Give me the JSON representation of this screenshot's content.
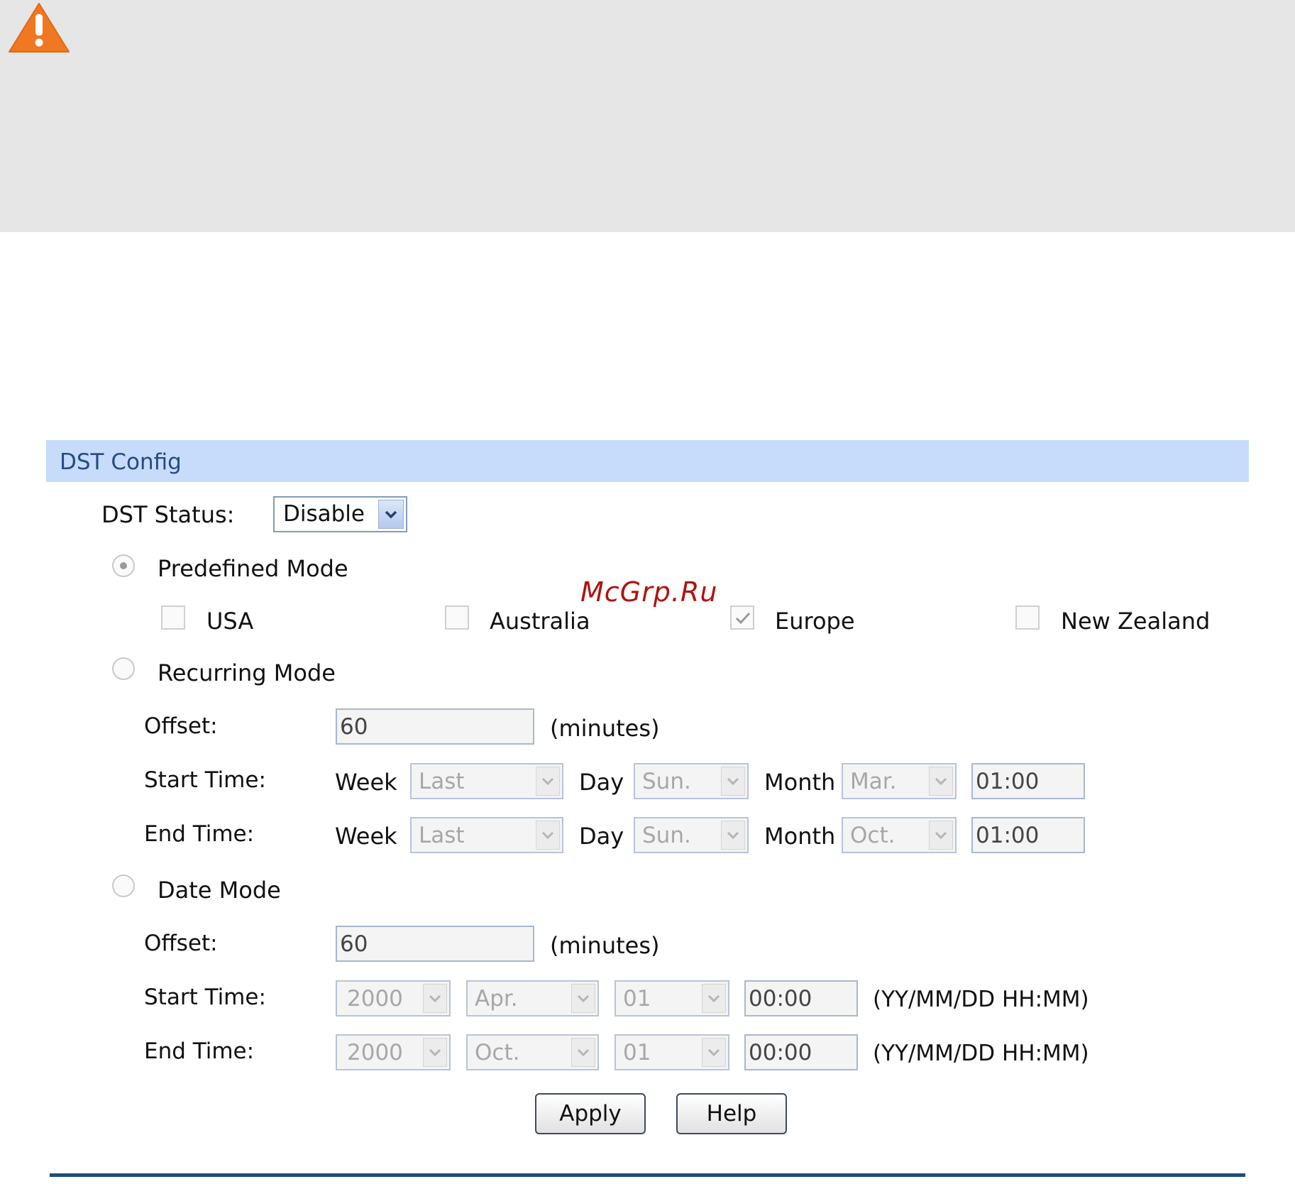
{
  "warning": {
    "icon": "warning-triangle-icon",
    "color": "#f07820"
  },
  "section": {
    "title": "DST Config",
    "header_color": "#c6dcfa"
  },
  "dst_status": {
    "label": "DST Status:",
    "value": "Disable"
  },
  "predefined": {
    "label": "Predefined Mode",
    "options": [
      {
        "label": "USA",
        "checked": false
      },
      {
        "label": "Australia",
        "checked": false
      },
      {
        "label": "Europe",
        "checked": true
      },
      {
        "label": "New Zealand",
        "checked": false
      }
    ]
  },
  "recurring": {
    "label": "Recurring Mode",
    "offset_label": "Offset:",
    "offset_value": "60",
    "offset_unit": "(minutes)",
    "start": {
      "label": "Start Time:",
      "week_label": "Week",
      "week": "Last",
      "day_label": "Day",
      "day": "Sun.",
      "month_label": "Month",
      "month": "Mar.",
      "time": "01:00"
    },
    "end": {
      "label": "End Time:",
      "week_label": "Week",
      "week": "Last",
      "day_label": "Day",
      "day": "Sun.",
      "month_label": "Month",
      "month": "Oct.",
      "time": "01:00"
    }
  },
  "date_mode": {
    "label": "Date Mode",
    "offset_label": "Offset:",
    "offset_value": "60",
    "offset_unit": "(minutes)",
    "start": {
      "label": "Start Time:",
      "year": "2000",
      "month": "Apr.",
      "day": "01",
      "time": "00:00",
      "format": "(YY/MM/DD HH:MM)"
    },
    "end": {
      "label": "End Time:",
      "year": "2000",
      "month": "Oct.",
      "day": "01",
      "time": "00:00",
      "format": "(YY/MM/DD HH:MM)"
    }
  },
  "buttons": {
    "apply": "Apply",
    "help": "Help"
  },
  "watermark": "McGrp.Ru"
}
